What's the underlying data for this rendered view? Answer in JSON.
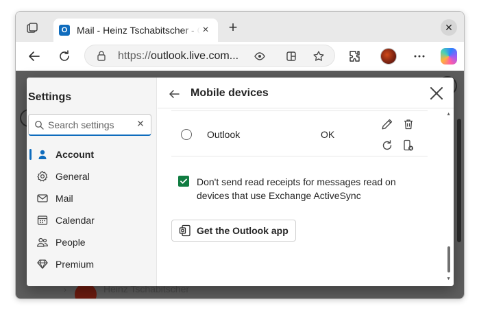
{
  "browser": {
    "tab": {
      "title": "Mail - Heinz Tschabitscher - Outlook",
      "favicon_letter": "O"
    },
    "address": {
      "protocol": "https://",
      "host": "outlook.live.com..."
    },
    "icons": [
      "workspaces-icon",
      "back-icon",
      "refresh-icon",
      "lock-icon",
      "read-aloud-icon",
      "split-screen-icon",
      "favorite-star-icon",
      "extensions-icon",
      "profile-avatar",
      "more-icon",
      "copilot-icon"
    ]
  },
  "background": {
    "user_name": "Heinz Tschabitscher"
  },
  "settings": {
    "title": "Settings",
    "search": {
      "placeholder": "Search settings",
      "value": ""
    },
    "nav": [
      {
        "label": "Account",
        "icon": "person-icon",
        "active": true
      },
      {
        "label": "General",
        "icon": "gear-icon",
        "active": false
      },
      {
        "label": "Mail",
        "icon": "mail-icon",
        "active": false
      },
      {
        "label": "Calendar",
        "icon": "calendar-icon",
        "active": false
      },
      {
        "label": "People",
        "icon": "people-icon",
        "active": false
      },
      {
        "label": "Premium",
        "icon": "diamond-icon",
        "active": false
      }
    ]
  },
  "panel": {
    "title": "Mobile devices",
    "device": {
      "name": "Outlook",
      "status": "OK"
    },
    "read_receipts": {
      "checked": true,
      "label": "Don't send read receipts for messages read on devices that use Exchange ActiveSync"
    },
    "get_app_label": "Get the Outlook app"
  },
  "colors": {
    "accent": "#0f6cbd",
    "checkbox": "#107c41",
    "overlay": "#5d5d5d"
  }
}
